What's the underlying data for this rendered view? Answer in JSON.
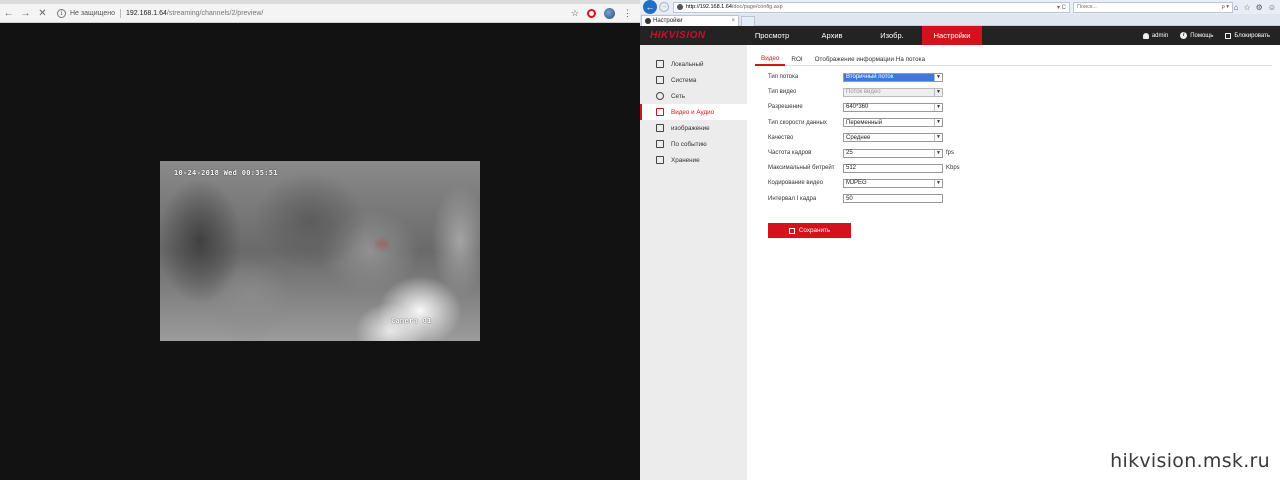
{
  "left": {
    "url_security": "Не защищено",
    "url_host": "192.168.1.64",
    "url_path": "/streaming/channels/2/preview/",
    "osd_time": "10-24-2018 Wed 00:35:51",
    "osd_camera": "Camera 01"
  },
  "right": {
    "address": {
      "host": "http://192.168.1.64",
      "path": "/doc/page/config.asp",
      "controls": "▾ C"
    },
    "search": {
      "placeholder": "Поиск...",
      "controls": "ρ ▾"
    },
    "tab": {
      "title": "Настройки",
      "close": "×"
    },
    "logo": "HIKVISION",
    "nav": [
      {
        "label": "Просмотр"
      },
      {
        "label": "Архив"
      },
      {
        "label": "Изобр."
      },
      {
        "label": "Настройки",
        "active": true
      }
    ],
    "user": {
      "name": "admin",
      "help": "Помощь",
      "logout": "Блокировать"
    },
    "sidebar": [
      {
        "label": "Локальный",
        "icon": "monitor-icon"
      },
      {
        "label": "Система",
        "icon": "system-icon"
      },
      {
        "label": "Сеть",
        "icon": "network-icon"
      },
      {
        "label": "Видео и Аудио",
        "icon": "video-audio-icon",
        "active": true
      },
      {
        "label": "изображение",
        "icon": "image-icon"
      },
      {
        "label": "По событию",
        "icon": "event-icon"
      },
      {
        "label": "Хранение",
        "icon": "storage-icon"
      }
    ],
    "tabs": [
      {
        "label": "Видео",
        "active": true
      },
      {
        "label": "ROI"
      },
      {
        "label": "Отображение информации На потока"
      }
    ],
    "form": [
      {
        "label": "Тип потока",
        "value": "Вторичный поток",
        "type": "select",
        "state": "selected"
      },
      {
        "label": "Тип видео",
        "value": "Поток видео",
        "type": "select",
        "state": "disabled"
      },
      {
        "label": "Разрешение",
        "value": "640*360",
        "type": "select"
      },
      {
        "label": "Тип скорости данных",
        "value": "Переменный",
        "type": "select"
      },
      {
        "label": "Качество",
        "value": "Среднее",
        "type": "select"
      },
      {
        "label": "Частота кадров",
        "value": "25",
        "type": "select",
        "unit": "fps"
      },
      {
        "label": "Максимальный битрейт",
        "value": "512",
        "type": "input",
        "unit": "Kbps"
      },
      {
        "label": "Кодирование видео",
        "value": "MJPEG",
        "type": "select"
      },
      {
        "label": "Интервал I кадра",
        "value": "50",
        "type": "input"
      }
    ],
    "save_label": "Сохранить"
  },
  "watermark": "hikvision.msk.ru",
  "colors": {
    "accent": "#d4121b",
    "header": "#232323",
    "selection": "#3b7bd6"
  }
}
